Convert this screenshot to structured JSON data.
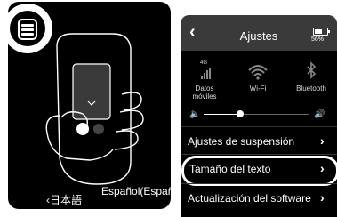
{
  "left": {
    "lang_prev": "‹日本語",
    "lang_current": "Español(España)",
    "lang_next": "›"
  },
  "right": {
    "title": "Ajustes",
    "battery": "56%",
    "quick": [
      {
        "label": "Datos móviles",
        "icon": "cellular-4g-icon"
      },
      {
        "label": "Wi-Fi",
        "icon": "wifi-icon"
      },
      {
        "label": "Bluetooth",
        "icon": "bluetooth-icon"
      }
    ],
    "signal_badge": "4G",
    "volume_level": 0.35,
    "menu": [
      {
        "label": "Ajustes de suspensión"
      },
      {
        "label": "Tamaño del texto"
      },
      {
        "label": "Actualización del software"
      }
    ]
  }
}
